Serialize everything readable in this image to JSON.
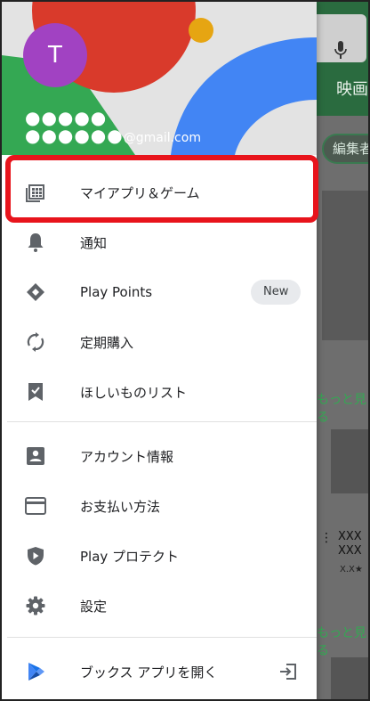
{
  "background": {
    "tab_label": "映画",
    "chip_label": "編集者",
    "see_more_1": "もっと見る",
    "see_more_2": "もっと見る",
    "app_title_line1": "XXX",
    "app_title_line2": "XXX",
    "rating": "X.X★"
  },
  "account": {
    "avatar_initial": "T",
    "name_masked": "●●●●●",
    "email_masked": "●●●●●●",
    "email_domain": "@gmail.com"
  },
  "menu": [
    {
      "label": "マイアプリ＆ゲーム",
      "icon": "apps-grid-icon"
    },
    {
      "label": "通知",
      "icon": "bell-icon"
    },
    {
      "label": "Play Points",
      "icon": "diamond-icon",
      "badge": "New"
    },
    {
      "label": "定期購入",
      "icon": "refresh-icon"
    },
    {
      "label": "ほしいものリスト",
      "icon": "bookmark-check-icon"
    },
    {
      "label": "アカウント情報",
      "icon": "account-box-icon"
    },
    {
      "label": "お支払い方法",
      "icon": "credit-card-icon"
    },
    {
      "label": "Play プロテクト",
      "icon": "shield-icon"
    },
    {
      "label": "設定",
      "icon": "gear-icon"
    },
    {
      "label": "ブックス アプリを開く",
      "icon": "play-books-icon",
      "trailing_icon": "open-app-icon"
    }
  ],
  "colors": {
    "highlight": "#e8141c",
    "avatar": "#a142c2",
    "play_green": "#34a853"
  }
}
